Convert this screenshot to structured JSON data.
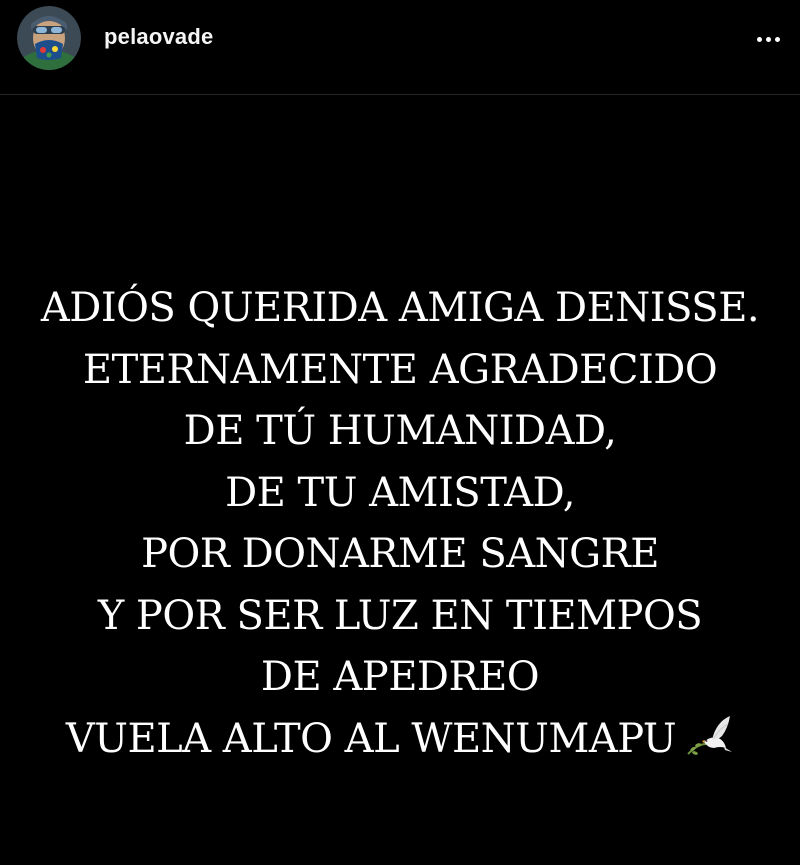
{
  "header": {
    "username": "pelaovade",
    "more_options_icon": "ellipsis-icon"
  },
  "post": {
    "background_color": "#000000",
    "text_color": "#ffffff",
    "lines": [
      "ADIÓS QUERIDA AMIGA DENISSE.",
      "ETERNAMENTE AGRADECIDO",
      "DE TÚ HUMANIDAD,",
      "DE TU AMISTAD,",
      "POR DONARME SANGRE",
      "Y POR SER LUZ EN TIEMPOS",
      "DE APEDREO",
      "VUELA ALTO AL WENUMAPU"
    ],
    "trailing_icon": "dove-icon"
  }
}
